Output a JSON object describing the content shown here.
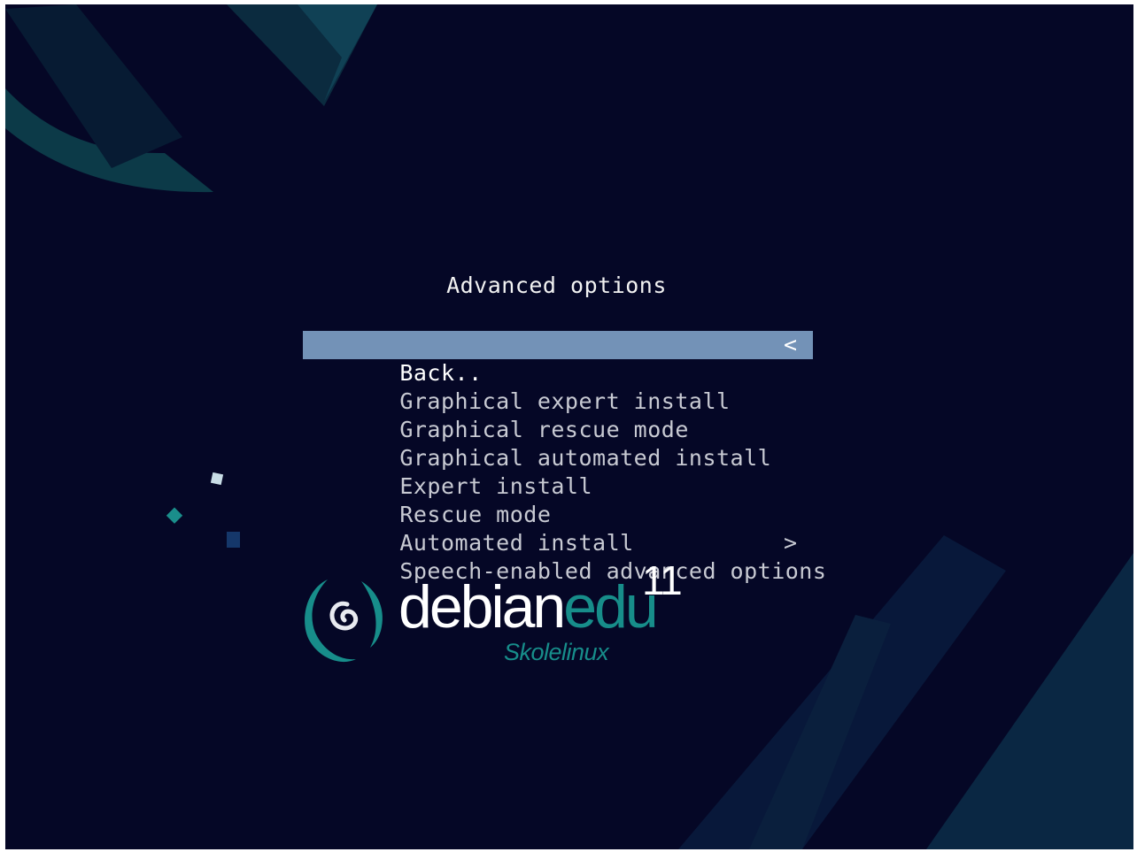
{
  "menu": {
    "title": "Advanced options",
    "items": [
      {
        "label": "Back..",
        "arrow": "<",
        "selected": true
      },
      {
        "label": "Graphical expert install",
        "arrow": "",
        "selected": false
      },
      {
        "label": "Graphical rescue mode",
        "arrow": "",
        "selected": false
      },
      {
        "label": "Graphical automated install",
        "arrow": "",
        "selected": false
      },
      {
        "label": "Expert install",
        "arrow": "",
        "selected": false
      },
      {
        "label": "Rescue mode",
        "arrow": "",
        "selected": false
      },
      {
        "label": "Automated install",
        "arrow": "",
        "selected": false
      },
      {
        "label": "Speech-enabled advanced options",
        "arrow": ">",
        "selected": false
      }
    ]
  },
  "logo": {
    "word_part1": "debian",
    "word_part2": "edu",
    "version": "11",
    "subtitle": "Skolelinux"
  },
  "colors": {
    "background": "#050726",
    "selection": "#7392b7",
    "accent": "#178d8a",
    "text": "#c8cad3"
  },
  "icons": {
    "logo_mark": "debian-swirl-icon"
  }
}
